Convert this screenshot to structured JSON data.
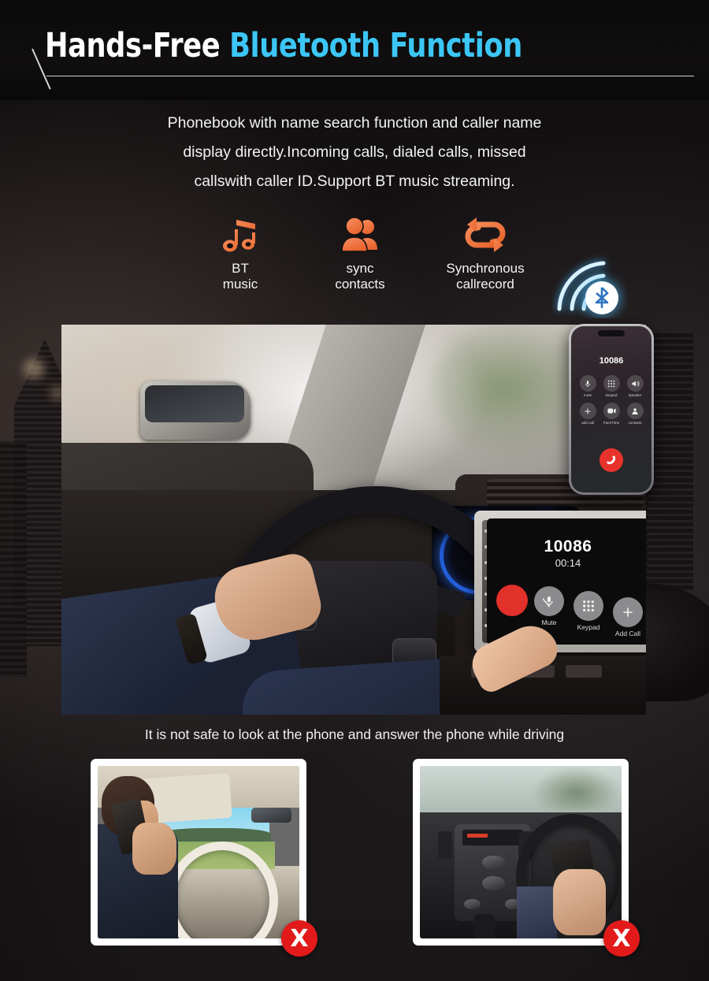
{
  "header": {
    "title_part1": "Hands-Free ",
    "title_part2": "Bluetooth Function",
    "title_color_white": "#ffffff",
    "title_color_cyan": "#3cc6f5"
  },
  "description": {
    "line1": "Phonebook with name search function and caller name",
    "line2": "display directly.Incoming calls, dialed calls, missed",
    "line3": "callswith caller ID.Support BT music streaming."
  },
  "features": {
    "accent_color": "#f07a45",
    "items": [
      {
        "icon": "music-note-icon",
        "label_line1": "BT",
        "label_line2": "music"
      },
      {
        "icon": "contacts-people-icon",
        "label_line1": "sync",
        "label_line2": "contacts"
      },
      {
        "icon": "sync-arrows-icon",
        "label_line1": "Synchronous",
        "label_line2": "callrecord"
      }
    ],
    "bluetooth_signal_icon": "bluetooth-signal-icon",
    "bluetooth_glow_color": "#4ab9f0"
  },
  "head_unit": {
    "number": "10086",
    "duration": "00:14",
    "end_call_color": "#e2302a",
    "buttons": [
      {
        "icon": "microphone-mute-icon",
        "label": "Mute"
      },
      {
        "icon": "keypad-grid-icon",
        "label": "Keypad"
      },
      {
        "icon": "plus-icon",
        "label": "Add Call"
      }
    ]
  },
  "phone": {
    "number": "10086",
    "end_call_color": "#e8332c",
    "buttons": [
      {
        "icon": "microphone-mute-icon",
        "label": "mute"
      },
      {
        "icon": "keypad-grid-icon",
        "label": "keypad"
      },
      {
        "icon": "speaker-icon",
        "label": "speaker"
      },
      {
        "icon": "plus-icon",
        "label": "add call"
      },
      {
        "icon": "facetime-video-icon",
        "label": "FaceTime"
      },
      {
        "icon": "contact-person-icon",
        "label": "contacts"
      }
    ]
  },
  "safety": {
    "note": "It is not safe to look at the phone and answer the phone while driving"
  },
  "cards": [
    {
      "name": "driver-holding-phone-to-ear",
      "badge": "X",
      "badge_color": "#e21a1a"
    },
    {
      "name": "driver-looking-at-phone-dashboard",
      "badge": "X",
      "badge_color": "#e21a1a"
    }
  ]
}
